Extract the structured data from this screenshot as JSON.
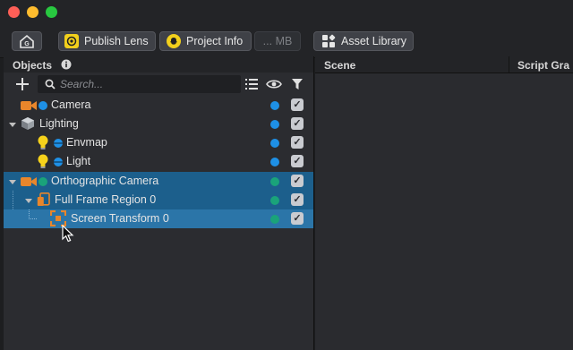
{
  "toolbar": {
    "home_label": "",
    "publish_label": "Publish Lens",
    "project_info_label": "Project Info",
    "size_label": "... MB",
    "asset_library_label": "Asset Library"
  },
  "objects_panel": {
    "title": "Objects",
    "search_placeholder": "Search...",
    "rows": [
      {
        "label": "Camera",
        "dot_color": "#1e90e6",
        "icon": "camera-icon",
        "checked": true
      },
      {
        "label": "Lighting",
        "dot_color": "#1e90e6",
        "icon": "cube-icon",
        "checked": true
      },
      {
        "label": "Envmap",
        "dot_color": "#1e90e6",
        "icon": "bulb-icon",
        "checked": true
      },
      {
        "label": "Light",
        "dot_color": "#1e90e6",
        "icon": "bulb-icon",
        "checked": true
      },
      {
        "label": "Orthographic Camera",
        "dot_color": "#1aa37a",
        "icon": "camera-icon",
        "checked": true
      },
      {
        "label": "Full Frame Region 0",
        "dot_color": "#1aa37a",
        "icon": "region-icon",
        "checked": true
      },
      {
        "label": "Screen Transform 0",
        "dot_color": "#1aa37a",
        "icon": "transform-icon",
        "checked": true
      }
    ]
  },
  "scene_panel": {
    "title": "Scene"
  },
  "script_graph_panel": {
    "title": "Script Gra"
  },
  "colors": {
    "accent": "#f2d01c",
    "selection": "#1c5f8c"
  }
}
